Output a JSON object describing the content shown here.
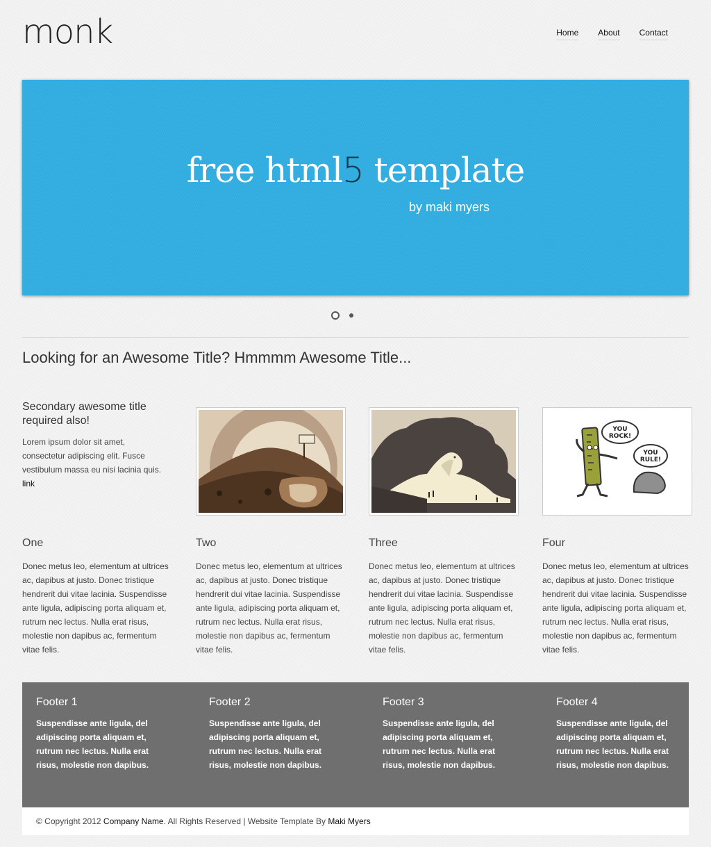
{
  "header": {
    "logo": "monk",
    "nav": [
      "Home",
      "About",
      "Contact"
    ]
  },
  "hero": {
    "title_part1": "free html",
    "title_digit": "5",
    "title_part2": " template",
    "subtitle": "by maki myers",
    "slide_count": 2,
    "active_slide": 1
  },
  "main": {
    "title": "Looking for an Awesome Title? Hmmmm Awesome Title...",
    "intro": {
      "heading": "Secondary awesome title required also!",
      "text": "Lorem ipsum dolor sit amet, consectetur adipiscing elit. Fusce vestibulum massa eu nisi lacinia quis.",
      "link": "link"
    },
    "thumbnails": [
      {
        "icon": "mountain-illustration"
      },
      {
        "icon": "dinosaur-illustration"
      },
      {
        "icon": "ruler-cartoon-illustration",
        "bubble1": "YOU ROCK!",
        "bubble2": "YOU RULE!"
      }
    ],
    "columns": [
      {
        "title": "One",
        "text": "Donec metus leo, elementum at ultrices ac, dapibus at justo. Donec tristique hendrerit dui vitae lacinia. Suspendisse ante ligula, adipiscing porta aliquam et, rutrum nec lectus. Nulla erat risus, molestie non dapibus ac, fermentum vitae felis."
      },
      {
        "title": "Two",
        "text": "Donec metus leo, elementum at ultrices ac, dapibus at justo. Donec tristique hendrerit dui vitae lacinia. Suspendisse ante ligula, adipiscing porta aliquam et, rutrum nec lectus. Nulla erat risus, molestie non dapibus ac, fermentum vitae felis."
      },
      {
        "title": "Three",
        "text": "Donec metus leo, elementum at ultrices ac, dapibus at justo. Donec tristique hendrerit dui vitae lacinia. Suspendisse ante ligula, adipiscing porta aliquam et, rutrum nec lectus. Nulla erat risus, molestie non dapibus ac, fermentum vitae felis."
      },
      {
        "title": "Four",
        "text": "Donec metus leo, elementum at ultrices ac, dapibus at justo. Donec tristique hendrerit dui vitae lacinia. Suspendisse ante ligula, adipiscing porta aliquam et, rutrum nec lectus. Nulla erat risus, molestie non dapibus ac, fermentum vitae felis."
      }
    ]
  },
  "footer": {
    "columns": [
      {
        "title": "Footer 1",
        "text": "Suspendisse ante ligula, del adipiscing porta aliquam et, rutrum nec lectus. Nulla erat risus, molestie non dapibus."
      },
      {
        "title": "Footer 2",
        "text": "Suspendisse ante ligula, del adipiscing porta aliquam et, rutrum nec lectus. Nulla erat risus, molestie non dapibus."
      },
      {
        "title": "Footer 3",
        "text": "Suspendisse ante ligula, del adipiscing porta aliquam et, rutrum nec lectus. Nulla erat risus, molestie non dapibus."
      },
      {
        "title": "Footer 4",
        "text": "Suspendisse ante ligula, del adipiscing porta aliquam et, rutrum nec lectus. Nulla erat risus, molestie non dapibus."
      }
    ],
    "copyright_prefix": "© Copyright 2012 ",
    "company": "Company Name",
    "copyright_mid": ". All Rights Reserved | Website Template By ",
    "author": "Maki Myers"
  },
  "colors": {
    "hero_bg": "#30ace0",
    "footer_bg": "#6f6f6f",
    "page_bg": "#f1f1f1"
  }
}
